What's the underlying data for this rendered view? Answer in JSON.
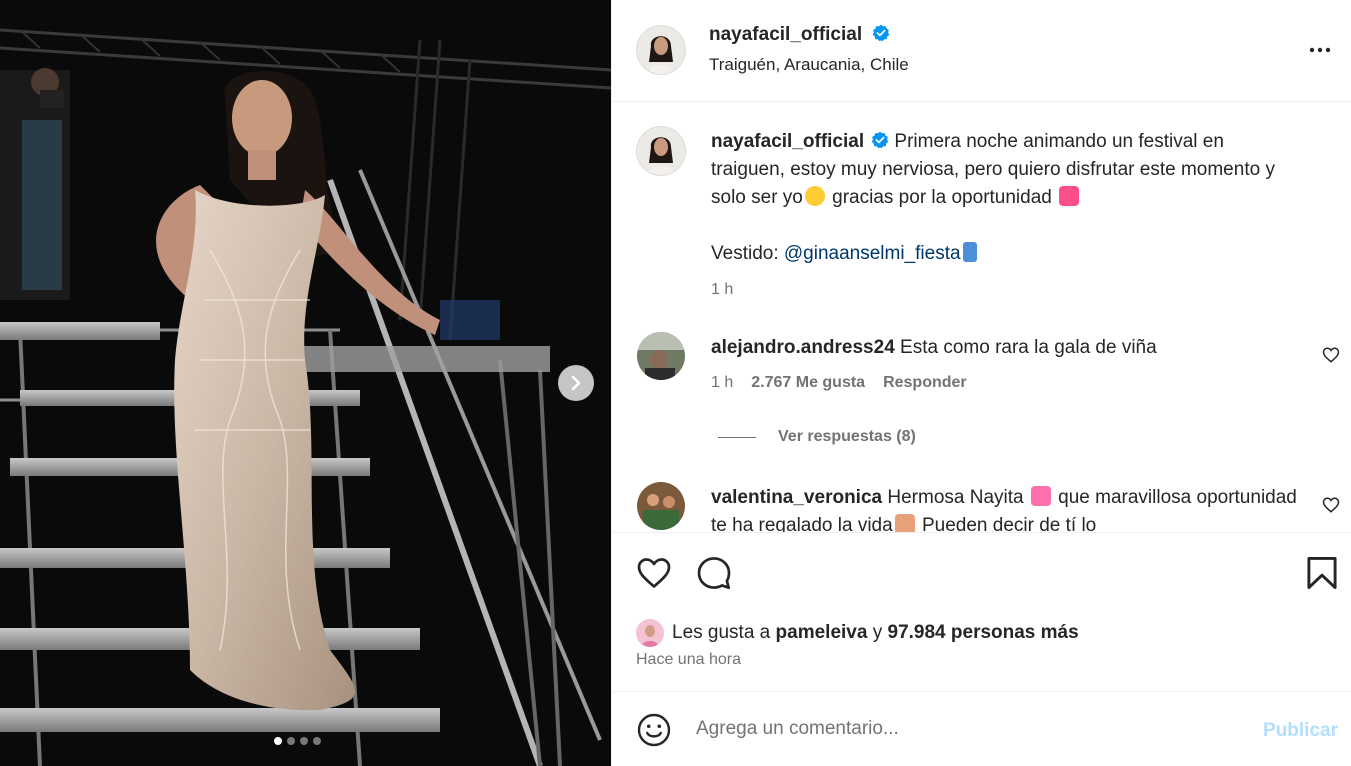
{
  "post": {
    "author": "nayafacil_official",
    "location": "Traiguén, Araucania, Chile",
    "carousel": {
      "total_slides": 4,
      "current_slide": 1
    }
  },
  "caption": {
    "username": "nayafacil_official",
    "line1": "Primera noche animando un festival en traiguen, estoy muy nerviosa, pero quiero disfrutar este momento y solo ser yo",
    "line2": "gracias por la oportunidad",
    "dress_prefix": "Vestido:",
    "dress_mention": "@ginaanselmi_fiesta",
    "time": "1 h"
  },
  "comments": [
    {
      "username": "alejandro.andress24",
      "text": "Esta como rara la gala de viña",
      "time": "1 h",
      "likes": "2.767 Me gusta",
      "reply_label": "Responder",
      "view_replies": "Ver respuestas (8)"
    },
    {
      "username": "valentina_veronica",
      "text_part1": "Hermosa Nayita",
      "text_part2": "que maravillosa oportunidad te ha regalado la vida",
      "text_part3": "Pueden decir de tí lo"
    }
  ],
  "likes": {
    "prefix": "Les gusta a",
    "user": "pameleiva",
    "connector": "y",
    "others": "97.984 personas más"
  },
  "post_time": "Hace una hora",
  "composer": {
    "placeholder": "Agrega un comentario...",
    "publish_label": "Publicar"
  },
  "icons": {
    "verified": "verified-badge-icon",
    "more": "more-options-icon",
    "like": "heart-icon",
    "comment": "comment-icon",
    "save": "bookmark-icon",
    "emoji": "emoji-icon",
    "next": "chevron-right-icon"
  },
  "colors": {
    "verified_blue": "#0095f6",
    "mention_blue": "#00376b",
    "secondary_text": "#737373",
    "publish_disabled": "#b2dffc"
  }
}
